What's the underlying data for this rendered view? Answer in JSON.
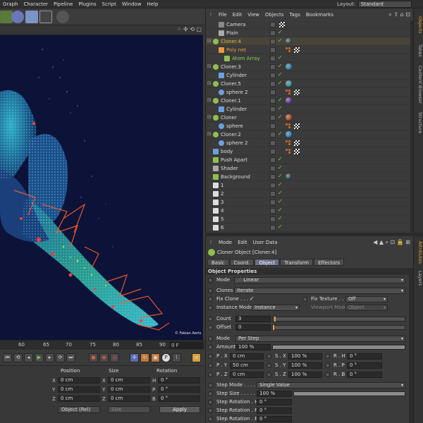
{
  "menubar": {
    "items": [
      "Graph",
      "Character",
      "Pipeline",
      "Plugins",
      "Script",
      "Window",
      "Help"
    ],
    "layout_label": "Layout:",
    "layout_value": "Standard"
  },
  "credit": "© Fabian Aerts",
  "timeline": {
    "ticks": [
      "60",
      "65",
      "70",
      "75",
      "80",
      "85",
      "90"
    ],
    "frame_field": "0 F"
  },
  "coordinates": {
    "headers": [
      "Position",
      "Size",
      "Rotation"
    ],
    "rows": [
      {
        "pos_axis": "X",
        "pos": "0 cm",
        "size_axis": "X",
        "size": "0 cm",
        "rot_axis": "H",
        "rot": "0 °"
      },
      {
        "pos_axis": "Y",
        "pos": "0 cm",
        "size_axis": "Y",
        "size": "0 cm",
        "rot_axis": "P",
        "rot": "0 °"
      },
      {
        "pos_axis": "Z",
        "pos": "0 cm",
        "size_axis": "Z",
        "size": "0 cm",
        "rot_axis": "B",
        "rot": "0 °"
      }
    ],
    "mode_select": "Object (Rel)",
    "size_select": "Size",
    "apply_label": "Apply"
  },
  "object_manager": {
    "menu": [
      "File",
      "Edit",
      "View",
      "Objects",
      "Tags",
      "Bookmarks"
    ],
    "objects": [
      {
        "name": "Camera",
        "indent": 1,
        "color": "default",
        "icon": "camera-icon",
        "tag": "checker"
      },
      {
        "name": "Plain",
        "indent": 1,
        "color": "default",
        "icon": "plain-icon",
        "tag": "check"
      },
      {
        "name": "Cloner.4",
        "indent": 0,
        "color": "yellow",
        "icon": "cloner-icon",
        "tag": "ball",
        "ball": "#2e4f55",
        "selected": true
      },
      {
        "name": "Poly net",
        "indent": 1,
        "color": "orange",
        "icon": "polynet-icon",
        "tag": "dots-checker"
      },
      {
        "name": "Atom Array",
        "indent": 2,
        "color": "green",
        "icon": "atom-array-icon",
        "tag": "check"
      },
      {
        "name": "Cloner.3",
        "indent": 0,
        "color": "default",
        "icon": "cloner-icon",
        "tag": "ball",
        "ball": "#2a8fbf"
      },
      {
        "name": "Cylinder",
        "indent": 1,
        "color": "default",
        "icon": "cylinder-icon",
        "tag": "check"
      },
      {
        "name": "Cloner.5",
        "indent": 0,
        "color": "default",
        "icon": "cloner-icon",
        "tag": "ball",
        "ball": "#3aa09a"
      },
      {
        "name": "sphere 2",
        "indent": 1,
        "color": "default",
        "icon": "sphere-icon",
        "tag": "dots-checker"
      },
      {
        "name": "Cloner.1",
        "indent": 0,
        "color": "default",
        "icon": "cloner-icon",
        "tag": "ball",
        "ball": "#6b3bb0"
      },
      {
        "name": "Cylinder",
        "indent": 1,
        "color": "default",
        "icon": "cylinder-icon",
        "tag": "check"
      },
      {
        "name": "Cloner",
        "indent": 0,
        "color": "default",
        "icon": "cloner-icon",
        "tag": "ball",
        "ball": "#d04a20"
      },
      {
        "name": "sphere",
        "indent": 1,
        "color": "default",
        "icon": "sphere-icon",
        "tag": "dots-checker"
      },
      {
        "name": "Cloner.2",
        "indent": 0,
        "color": "default",
        "icon": "cloner-icon",
        "tag": "ball",
        "ball": "#2a8fd0"
      },
      {
        "name": "sphere 2",
        "indent": 1,
        "color": "default",
        "icon": "sphere-icon",
        "tag": "dots-checker"
      },
      {
        "name": "body",
        "indent": 0,
        "color": "default",
        "icon": "body-icon",
        "tag": "dots-checker"
      },
      {
        "name": "Push Apart",
        "indent": 0,
        "color": "default",
        "icon": "push-apart-icon",
        "tag": "check"
      },
      {
        "name": "Shader",
        "indent": 0,
        "color": "default",
        "icon": "shader-icon",
        "tag": "check"
      },
      {
        "name": "Background",
        "indent": 0,
        "color": "default",
        "icon": "background-icon",
        "tag": "ball",
        "ball": "#2e4f55"
      },
      {
        "name": "1",
        "indent": 0,
        "color": "default",
        "icon": "null-icon",
        "tag": "check"
      },
      {
        "name": "2",
        "indent": 0,
        "color": "default",
        "icon": "null-icon",
        "tag": "check"
      },
      {
        "name": "3",
        "indent": 0,
        "color": "default",
        "icon": "null-icon",
        "tag": "check"
      },
      {
        "name": "4",
        "indent": 0,
        "color": "default",
        "icon": "null-icon",
        "tag": "check"
      },
      {
        "name": "5",
        "indent": 0,
        "color": "default",
        "icon": "null-icon",
        "tag": "check"
      },
      {
        "name": "6",
        "indent": 0,
        "color": "default",
        "icon": "null-icon",
        "tag": "check"
      }
    ]
  },
  "attribute_manager": {
    "menu": [
      "Mode",
      "Edit",
      "User Data"
    ],
    "title": "Cloner Object [Cloner.4]",
    "tabs": [
      "Basic",
      "Coord.",
      "Object",
      "Transform",
      "Effectors"
    ],
    "active_tab": "Object",
    "section": "Object Properties",
    "mode_label": "Mode",
    "mode_value": "Linear",
    "clones_label": "Clones",
    "clones_value": "Iterate",
    "fix_clone_label": "Fix Clone . . . .",
    "fix_clone_check": "✓",
    "fix_texture_label": "Fix Texture . . .",
    "fix_texture_value": "Off",
    "instance_mode_label": "Instance Mode",
    "instance_mode_value": "Instance",
    "viewport_mode_label": "Viewport Mode",
    "viewport_mode_value": "Object",
    "count_label": "Count",
    "count_value": "3",
    "offset_label": "Offset",
    "offset_value": "0",
    "mode2_label": "Mode",
    "mode2_value": "Per Step",
    "amount_label": "Amount",
    "amount_value": "100 %",
    "p_x_label": "P . X",
    "p_x": "0 cm",
    "p_y_label": "P . Y",
    "p_y": "50 cm",
    "p_z_label": "P . Z",
    "p_z": "0 cm",
    "s_x_label": "S . X",
    "s_x": "100 %",
    "s_y_label": "S . Y",
    "s_y": "100 %",
    "s_z_label": "S . Z",
    "s_z": "100 %",
    "r_h_label": "R . H",
    "r_h": "0 °",
    "r_p_label": "R . P",
    "r_p": "0 °",
    "r_b_label": "R . B",
    "r_b": "0 °",
    "step_mode_label": "Step Mode . . . . .",
    "step_mode_value": "Single Value",
    "step_size_label": "Step Size . . . . . .",
    "step_size_value": "100 %",
    "step_rot_h_label": "Step Rotation . H",
    "step_rot_h": "0 °",
    "step_rot_p_label": "Step Rotation . P",
    "step_rot_p": "0 °",
    "step_rot_b_label": "Step Rotation . B",
    "step_rot_b": "0 °"
  },
  "side_tabs_top": [
    "Objects",
    "Takes",
    "Content Browser",
    "Structure"
  ],
  "side_tabs_bottom": [
    "Attributes",
    "Layers"
  ],
  "colors": {
    "accent": "#e8a040",
    "selected_tab": "#6b6f86",
    "viewport_bg": "#0b1030"
  }
}
